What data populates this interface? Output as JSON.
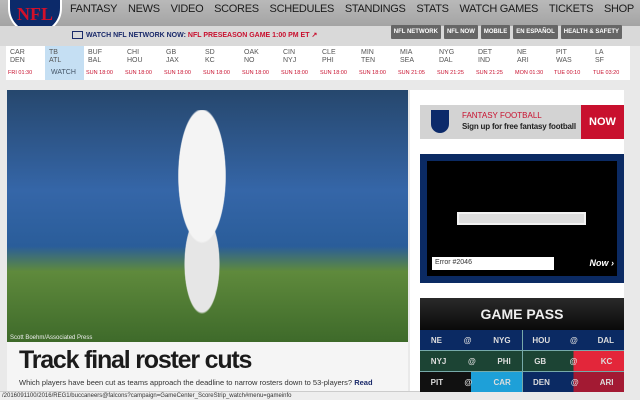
{
  "nav": {
    "logo": "NFL",
    "items": [
      "FANTASY",
      "NEWS",
      "VIDEO",
      "SCORES",
      "SCHEDULES",
      "STANDINGS",
      "STATS",
      "WATCH GAMES",
      "TICKETS",
      "SHOP"
    ]
  },
  "subbar": {
    "watch_label": "WATCH NFL NETWORK NOW:",
    "watch_link": "NFL PRESEASON GAME 1:00 PM ET",
    "buttons": [
      "NFL NETWORK",
      "NFL NOW",
      "MOBILE",
      "EN ESPAÑOL",
      "HEALTH & SAFETY"
    ]
  },
  "scores": [
    {
      "away": "CAR",
      "home": "DEN",
      "time": "FRI 01:30"
    },
    {
      "away": "TB",
      "home": "ATL",
      "time": "WATCH",
      "selected": true
    },
    {
      "away": "BUF",
      "home": "BAL",
      "time": "SUN 18:00"
    },
    {
      "away": "CHI",
      "home": "HOU",
      "time": "SUN 18:00"
    },
    {
      "away": "GB",
      "home": "JAX",
      "time": "SUN 18:00"
    },
    {
      "away": "SD",
      "home": "KC",
      "time": "SUN 18:00"
    },
    {
      "away": "OAK",
      "home": "NO",
      "time": "SUN 18:00"
    },
    {
      "away": "CIN",
      "home": "NYJ",
      "time": "SUN 18:00"
    },
    {
      "away": "CLE",
      "home": "PHI",
      "time": "SUN 18:00"
    },
    {
      "away": "MIN",
      "home": "TEN",
      "time": "SUN 18:00"
    },
    {
      "away": "MIA",
      "home": "SEA",
      "time": "SUN 21:05"
    },
    {
      "away": "NYG",
      "home": "DAL",
      "time": "SUN 21:25"
    },
    {
      "away": "DET",
      "home": "IND",
      "time": "SUN 21:25"
    },
    {
      "away": "NE",
      "home": "ARI",
      "time": "MON 01:30"
    },
    {
      "away": "PIT",
      "home": "WAS",
      "time": "TUE 00:10"
    },
    {
      "away": "LA",
      "home": "SF",
      "time": "TUE 03:20"
    }
  ],
  "hero": {
    "credit": "Scott Boehm/Associated Press",
    "headline": "Track final roster cuts",
    "dek": "Which players have been cut as teams approach the deadline to narrow rosters down to 53-players?",
    "read": "Read"
  },
  "fantasy_ad": {
    "line1": "FANTASY FOOTBALL",
    "line2": "Sign up for free fantasy football",
    "cta": "NOW"
  },
  "video": {
    "error": "Error #2046",
    "brand": "Now ›"
  },
  "gamepass": {
    "title": "GAME PASS",
    "matchups": [
      [
        "NE",
        "NYG"
      ],
      [
        "HOU",
        "DAL"
      ],
      [
        "NYJ",
        "PHI"
      ],
      [
        "GB",
        "KC"
      ],
      [
        "PIT",
        "CAR"
      ],
      [
        "DEN",
        "ARI"
      ]
    ],
    "at": "@"
  },
  "status_url": "/2016091100/2016/REG1/buccaneers@falcons?campaign=GameCenter_ScoreStrip_watch#menu=gameinfo"
}
